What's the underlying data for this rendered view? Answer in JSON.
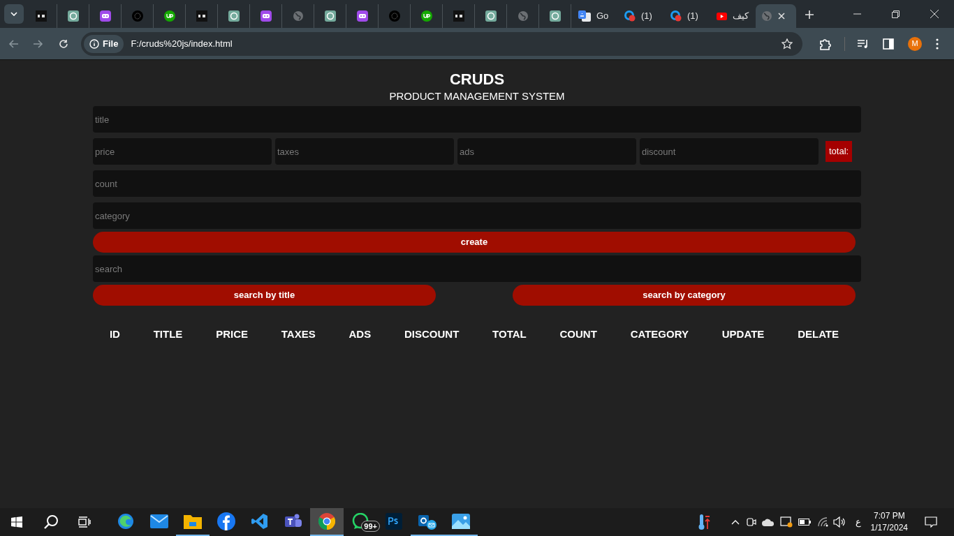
{
  "browser": {
    "tabs": [
      {
        "kind": "bai",
        "selected": false
      },
      {
        "kind": "gpt",
        "selected": false
      },
      {
        "kind": "bot",
        "selected": false
      },
      {
        "kind": "dots",
        "selected": false
      },
      {
        "kind": "up",
        "selected": false
      },
      {
        "kind": "bai",
        "selected": false
      },
      {
        "kind": "gpt",
        "selected": false
      },
      {
        "kind": "bot",
        "selected": false
      },
      {
        "kind": "globe",
        "selected": false
      },
      {
        "kind": "gpt",
        "selected": false
      },
      {
        "kind": "bot",
        "selected": false
      },
      {
        "kind": "dots",
        "selected": false
      },
      {
        "kind": "up",
        "selected": false
      },
      {
        "kind": "bai",
        "selected": false
      },
      {
        "kind": "gpt",
        "selected": false
      },
      {
        "kind": "globe",
        "selected": false
      },
      {
        "kind": "gpt",
        "selected": false
      },
      {
        "kind": "translate",
        "title": "Go",
        "selected": false
      },
      {
        "kind": "badge",
        "title": "(1)",
        "selected": false
      },
      {
        "kind": "badge",
        "title": "(1)",
        "selected": false
      },
      {
        "kind": "youtube",
        "title": "كيف",
        "selected": false
      },
      {
        "kind": "globe",
        "selected": true
      }
    ],
    "scheme": "File",
    "url": "F:/cruds%20js/index.html",
    "profile": "M"
  },
  "page": {
    "title": "CRUDS",
    "subtitle": "PRODUCT MANAGEMENT SYSTEM",
    "title_field": {
      "placeholder": "title"
    },
    "cost_fields": [
      {
        "placeholder": "price"
      },
      {
        "placeholder": "taxes"
      },
      {
        "placeholder": "ads"
      },
      {
        "placeholder": "discount"
      }
    ],
    "total": "total:",
    "count_field": {
      "placeholder": "count"
    },
    "category_field": {
      "placeholder": "category"
    },
    "create": "create",
    "search_field": {
      "placeholder": "search"
    },
    "search_buttons": [
      "search by title",
      "search by category"
    ],
    "columns": [
      "ID",
      "TITLE",
      "PRICE",
      "TAXES",
      "ADS",
      "DISCOUNT",
      "TOTAL",
      "COUNT",
      "CATEGORY",
      "UPDATE",
      "DELATE"
    ]
  },
  "taskbar": {
    "apps": [
      {
        "kind": "edge",
        "running": false,
        "selected": false
      },
      {
        "kind": "mail",
        "running": false,
        "selected": false
      },
      {
        "kind": "folder",
        "running": true,
        "selected": false
      },
      {
        "kind": "facebook",
        "running": false,
        "selected": false
      },
      {
        "kind": "vscode",
        "running": false,
        "selected": false
      },
      {
        "kind": "teams",
        "running": false,
        "selected": false
      },
      {
        "kind": "chrome",
        "running": true,
        "selected": true
      },
      {
        "kind": "whatsapp",
        "running": false,
        "selected": false,
        "badge": "99+"
      },
      {
        "kind": "photoshop",
        "running": false,
        "selected": false
      },
      {
        "kind": "outlook",
        "running": true,
        "selected": false
      },
      {
        "kind": "photos",
        "running": true,
        "selected": false
      }
    ],
    "lang": "ع",
    "time": "7:07 PM",
    "date": "1/17/2024"
  }
}
